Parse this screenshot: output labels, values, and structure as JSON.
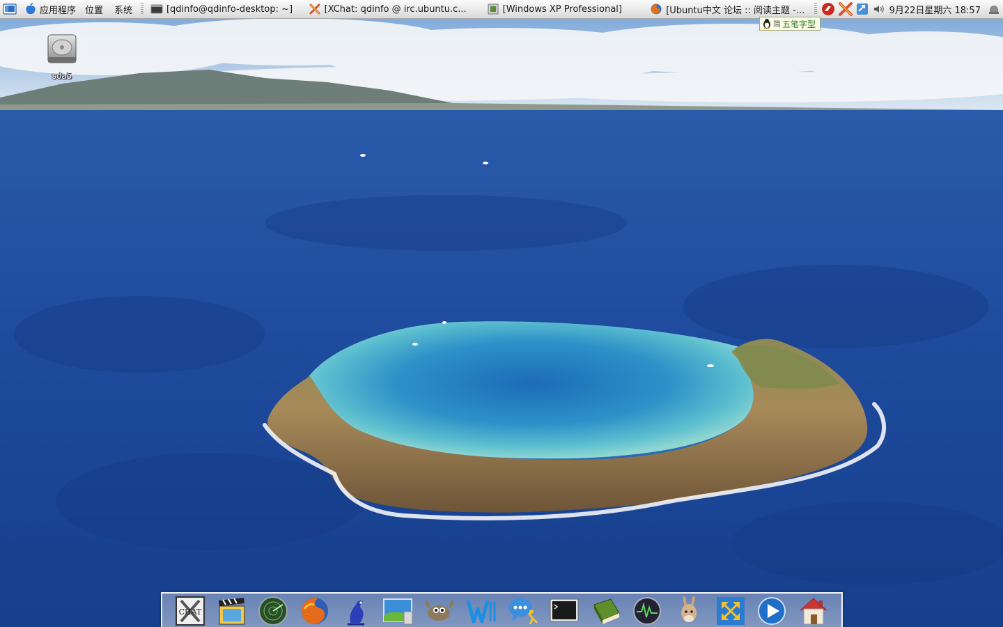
{
  "top_panel": {
    "menus": {
      "applications": "应用程序",
      "places": "位置",
      "system": "系统"
    },
    "tasks": [
      {
        "title": "[qdinfo@qdinfo-desktop: ~]",
        "icon": "terminal-icon"
      },
      {
        "title": "[XChat: qdinfo @ irc.ubuntu.c...",
        "icon": "xchat-icon"
      },
      {
        "title": "[Windows XP Professional]",
        "icon": "vmware-icon"
      },
      {
        "title": "[Ubuntu中文 论坛 :: 阅读主题 -...",
        "icon": "firefox-icon"
      }
    ],
    "clock": "9月22日星期六 18:57"
  },
  "ime": {
    "mode_char": "简",
    "label": "五笔字型"
  },
  "desktop": {
    "icons": [
      {
        "label": "sda5",
        "icon": "hard-drive-icon"
      }
    ]
  },
  "dock": {
    "items": [
      {
        "name": "xchat-launcher",
        "icon": "xchat-icon",
        "label": "CHAT"
      },
      {
        "name": "movie-player",
        "icon": "clapperboard-icon"
      },
      {
        "name": "radar",
        "icon": "radar-icon"
      },
      {
        "name": "firefox",
        "icon": "firefox-icon"
      },
      {
        "name": "pidgin",
        "icon": "pidgin-icon"
      },
      {
        "name": "image-viewer",
        "icon": "landscape-photo-icon"
      },
      {
        "name": "gimp",
        "icon": "gimp-icon"
      },
      {
        "name": "writer",
        "icon": "writer-w-icon"
      },
      {
        "name": "messenger",
        "icon": "chat-bubble-icon"
      },
      {
        "name": "terminal",
        "icon": "terminal-icon"
      },
      {
        "name": "dictionary",
        "icon": "book-icon"
      },
      {
        "name": "system-monitor",
        "icon": "monitor-wave-icon"
      },
      {
        "name": "amule",
        "icon": "donkey-icon"
      },
      {
        "name": "vmware",
        "icon": "vmware-icon"
      },
      {
        "name": "media-player",
        "icon": "play-icon"
      },
      {
        "name": "home-folder",
        "icon": "home-icon"
      }
    ]
  }
}
